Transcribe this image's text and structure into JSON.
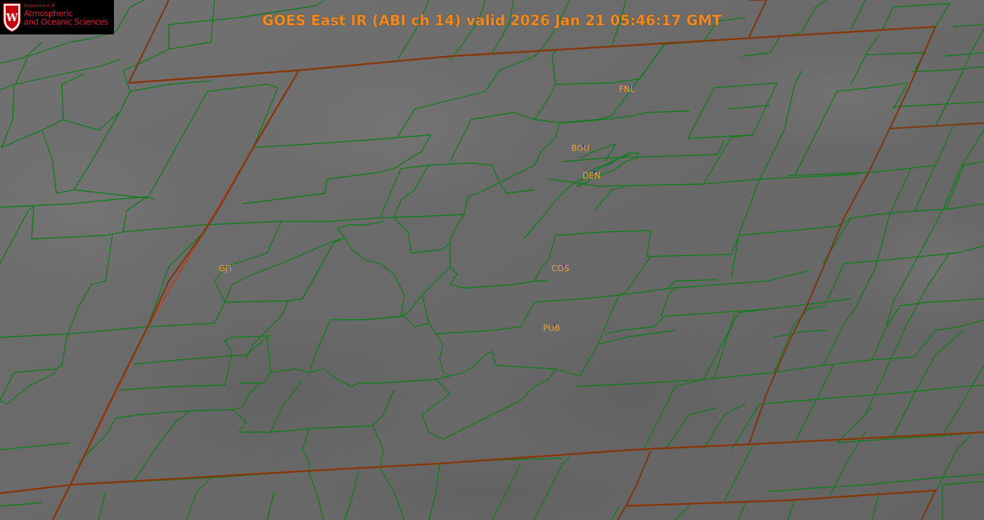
{
  "title": "GOES East IR (ABI ch 14) valid 2026 Jan 21 05:46:17 GMT",
  "logo": {
    "dept_line": "Department of",
    "line1": "Atmospheric",
    "line2": "and Oceanic Sciences",
    "crest_letter": "W",
    "icon": "uw-crest-icon"
  },
  "stations": [
    {
      "code": "FNL",
      "name": "station-fnl"
    },
    {
      "code": "BOU",
      "name": "station-bou"
    },
    {
      "code": "DEN",
      "name": "station-den"
    },
    {
      "code": "GJT",
      "name": "station-gjt"
    },
    {
      "code": "COS",
      "name": "station-cos"
    },
    {
      "code": "PUB",
      "name": "station-pub"
    }
  ],
  "colors": {
    "title": "#f08a1e",
    "station_label": "#f0a030",
    "station_marker": "#1a2bd8",
    "county_line": "#0e7d1a",
    "state_line": "#7a3a0c",
    "logo_bg": "#000000",
    "logo_text": "#d6232a",
    "ir_background": "#6b6b6b"
  }
}
